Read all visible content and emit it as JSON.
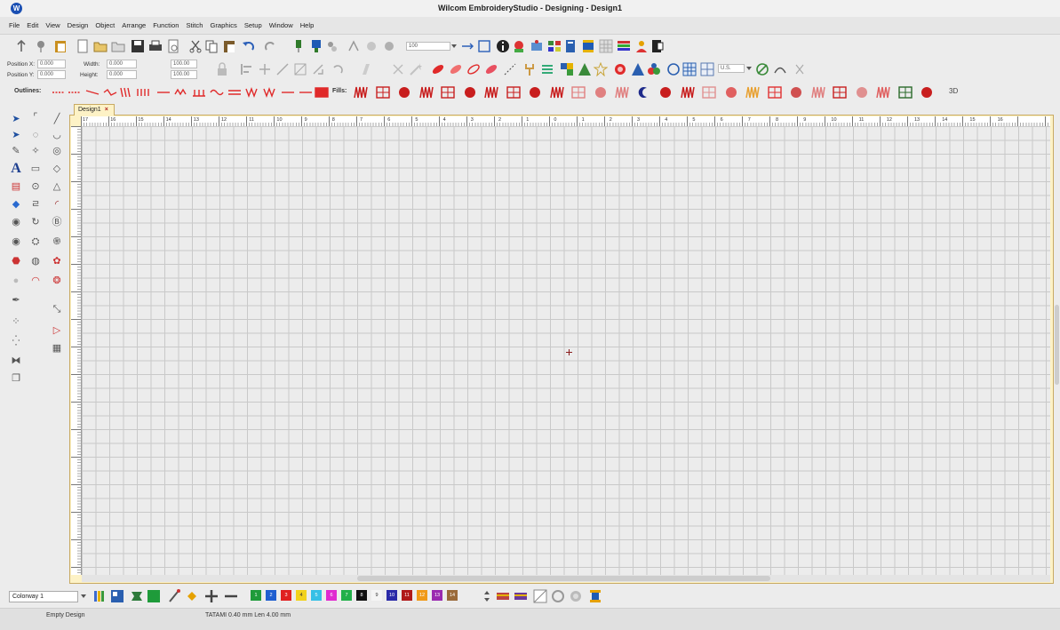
{
  "window": {
    "title": "Wilcom EmbroideryStudio - Designing - Design1",
    "app_icon": "wilcom-logo-icon"
  },
  "menu": [
    "File",
    "Edit",
    "View",
    "Design",
    "Object",
    "Arrange",
    "Function",
    "Stitch",
    "Graphics",
    "Setup",
    "Window",
    "Help"
  ],
  "toolbar": {
    "zoom_value": "100",
    "position_x_label": "Position X:",
    "position_x_value": "0.000",
    "position_y_label": "Position Y:",
    "position_y_value": "0.000",
    "width_label": "Width:",
    "width_value": "0.000",
    "height_label": "Height:",
    "height_value": "0.000",
    "scale_w_value": "100.00",
    "scale_h_value": "100.00",
    "units_value": "U.S.",
    "outlines_label": "Outlines:",
    "fills_label": "Fills:",
    "view_3d_label": "3D"
  },
  "document": {
    "tab_label": "Design1",
    "tab_close": "×",
    "hruler_ticks": [
      "17",
      "16",
      "15",
      "14",
      "13",
      "12",
      "11",
      "10",
      "9",
      "8",
      "7",
      "6",
      "5",
      "4",
      "3",
      "2",
      "1",
      "0",
      "1",
      "2",
      "3",
      "4",
      "5",
      "6",
      "7",
      "8",
      "9",
      "10",
      "11",
      "12",
      "13",
      "14",
      "15",
      "16"
    ]
  },
  "colorway": {
    "selected": "Colorway 1",
    "swatches": [
      {
        "num": "1",
        "color": "#1e9b3a"
      },
      {
        "num": "2",
        "color": "#1f5fd0"
      },
      {
        "num": "3",
        "color": "#e02020"
      },
      {
        "num": "4",
        "color": "#f2d21c"
      },
      {
        "num": "5",
        "color": "#36c0e6"
      },
      {
        "num": "6",
        "color": "#e02ad0"
      },
      {
        "num": "7",
        "color": "#22b04a"
      },
      {
        "num": "8",
        "color": "#111111"
      },
      {
        "num": "9",
        "color": "#f5f5f5"
      },
      {
        "num": "10",
        "color": "#2a2aa8"
      },
      {
        "num": "11",
        "color": "#b01818"
      },
      {
        "num": "12",
        "color": "#f09a18"
      },
      {
        "num": "13",
        "color": "#9a2ab0"
      },
      {
        "num": "14",
        "color": "#9a6a3a"
      }
    ]
  },
  "status": {
    "design_state": "Empty Design",
    "stitch_info": "TATAMI 0.40 mm Len 4.00 mm"
  }
}
